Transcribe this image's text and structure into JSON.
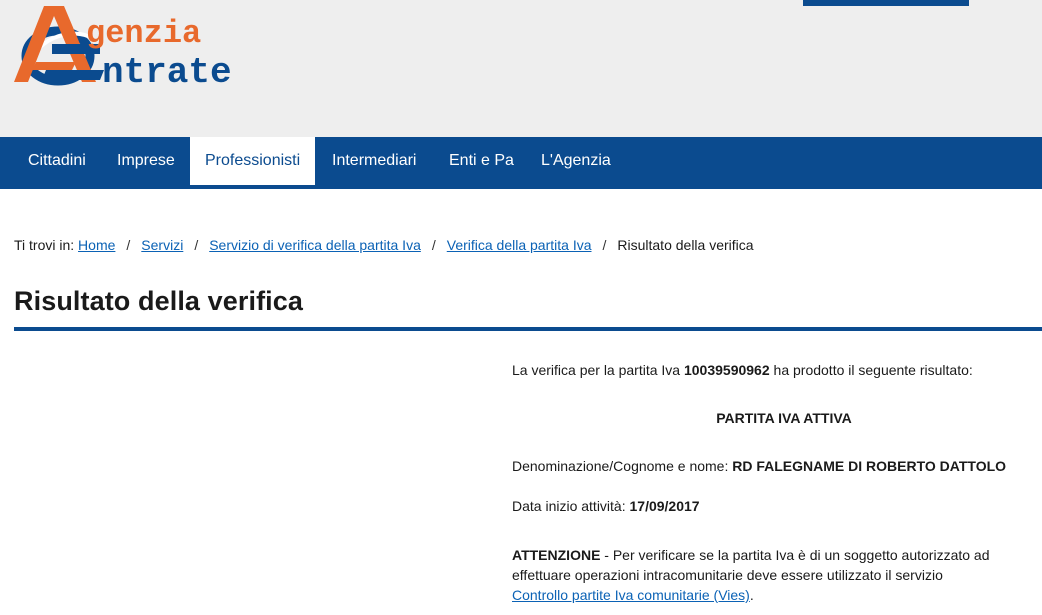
{
  "logo": {
    "line1": "genzia",
    "line2": "ntrate",
    "alt": "Agenzia Entrate"
  },
  "nav": {
    "items": [
      {
        "label": "Cittadini"
      },
      {
        "label": "Imprese"
      },
      {
        "label": "Professionisti"
      },
      {
        "label": "Intermediari"
      },
      {
        "label": "Enti e Pa"
      },
      {
        "label": "L'Agenzia"
      }
    ],
    "active": "Professionisti"
  },
  "breadcrumb": {
    "prefix": "Ti trovi in:",
    "separator": "/",
    "links": [
      "Home",
      "Servizi",
      "Servizio di verifica della partita Iva",
      "Verifica della partita Iva"
    ],
    "current": "Risultato della verifica"
  },
  "page_title": "Risultato della verifica",
  "result": {
    "intro_before": "La verifica per la partita Iva",
    "vat_number": "10039590962",
    "intro_after": "ha prodotto il seguente risultato:",
    "status": "PARTITA IVA ATTIVA",
    "name_label": "Denominazione/Cognome e nome:",
    "name_value": "RD FALEGNAME DI ROBERTO DATTOLO",
    "date_label": "Data inizio attività:",
    "date_value": "17/09/2017",
    "warning_title": "ATTENZIONE",
    "warning_text": "- Per verificare se la partita Iva è di un soggetto autorizzato ad effettuare operazioni intracomunitarie deve essere utilizzato il servizio",
    "warning_link": "Controllo partite Iva comunitarie (Vies)",
    "warning_end": "."
  },
  "colors": {
    "brand_blue": "#0b4b8f",
    "brand_orange": "#e8692c",
    "link": "#0b62b5"
  }
}
